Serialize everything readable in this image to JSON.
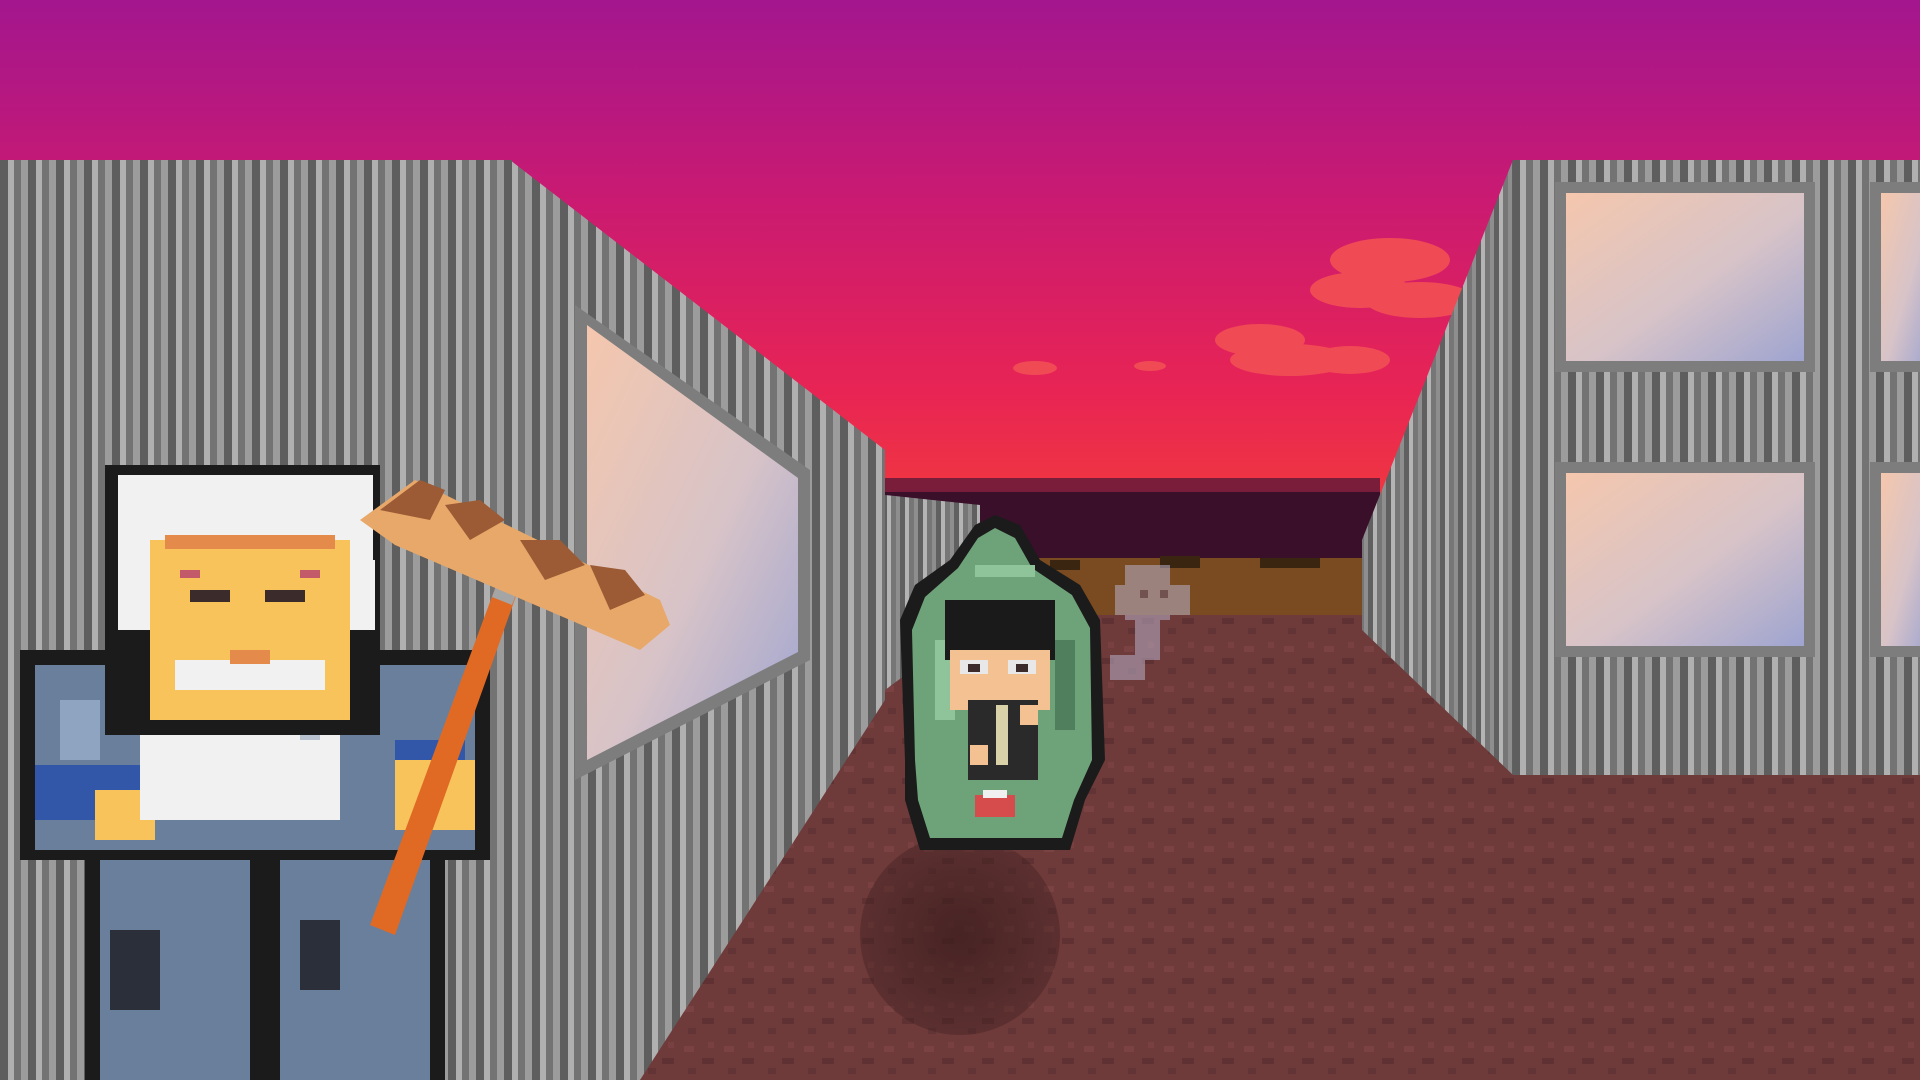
{
  "scene": {
    "kind": "first-person-alley",
    "time_of_day": "sunset",
    "colors": {
      "sky_top": "#a3168e",
      "sky_mid": "#d81c5e",
      "sky_low": "#f23a3d",
      "horizon_dark": "#3a0f2a",
      "ground": "#6e3a3a",
      "ground_dark": "#5c2f30",
      "wall_light": "#a9a9a9",
      "wall_dark": "#5e5e5e",
      "window_frame": "#7a7a7a",
      "window_glass_warm": "#f2c6b0",
      "window_glass_cool": "#a9a8cc",
      "cloud": "#f04a55"
    }
  },
  "characters": [
    {
      "id": "old-janitor",
      "holds": "broom",
      "hair": "#f1f1f1",
      "face": "#f7c35a",
      "clothes": "#6a7f9c"
    },
    {
      "id": "hooded-figure",
      "hood": "#6ea37a",
      "hair": "#1a1a1a"
    },
    {
      "id": "faint-ghost",
      "color": "#b8b0c8"
    }
  ],
  "hud": {}
}
